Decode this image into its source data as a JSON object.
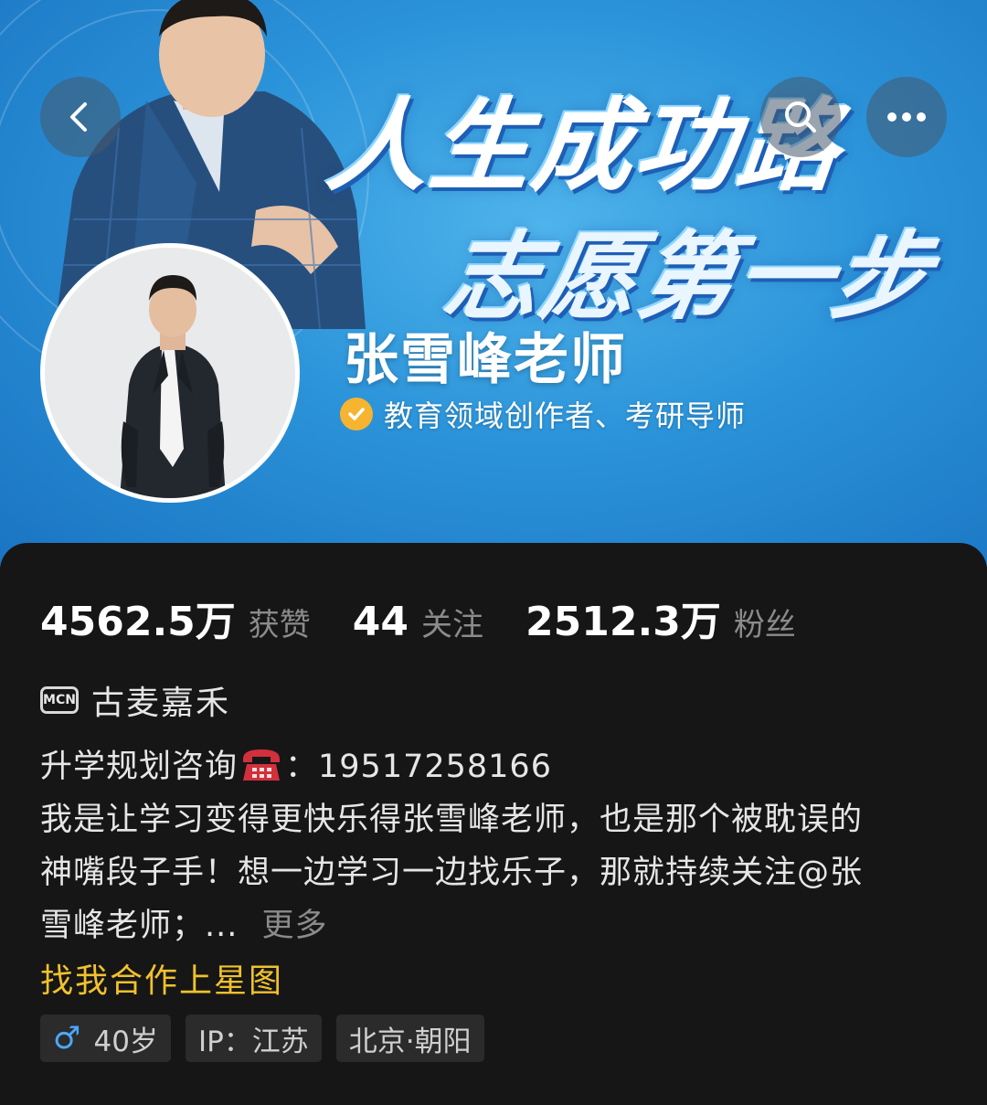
{
  "banner": {
    "slogan_line1": "人生成功路",
    "slogan_line2": "志愿第一步"
  },
  "nav": {
    "back_icon": "chevron-left-icon",
    "search_icon": "search-icon",
    "more_icon": "more-dots-icon"
  },
  "profile": {
    "name": "张雪峰老师",
    "verified_text": "教育领域创作者、考研导师",
    "verified_color": "#f6b431"
  },
  "stats": [
    {
      "value": "4562.5万",
      "label": "获赞"
    },
    {
      "value": "44",
      "label": "关注"
    },
    {
      "value": "2512.3万",
      "label": "粉丝"
    }
  ],
  "mcn": {
    "badge": "MCN",
    "name": "古麦嘉禾"
  },
  "bio": {
    "line1_prefix": "升学规划咨询",
    "line1_suffix": "：19517258166",
    "line2": "我是让学习变得更快乐得张雪峰老师，也是那个被耽误的",
    "line3": "神嘴段子手！想一边学习一边找乐子，那就持续关注@张",
    "line4": "雪峰老师；...",
    "more": "更多"
  },
  "cooperate_link": "找我合作上星图",
  "tags": {
    "age": "40岁",
    "gender_symbol": "♂",
    "ip": "IP：江苏",
    "location": "北京·朝阳"
  },
  "colors": {
    "accent_yellow": "#f0c12e",
    "male_blue": "#4aa8ff",
    "background": "#161616"
  }
}
